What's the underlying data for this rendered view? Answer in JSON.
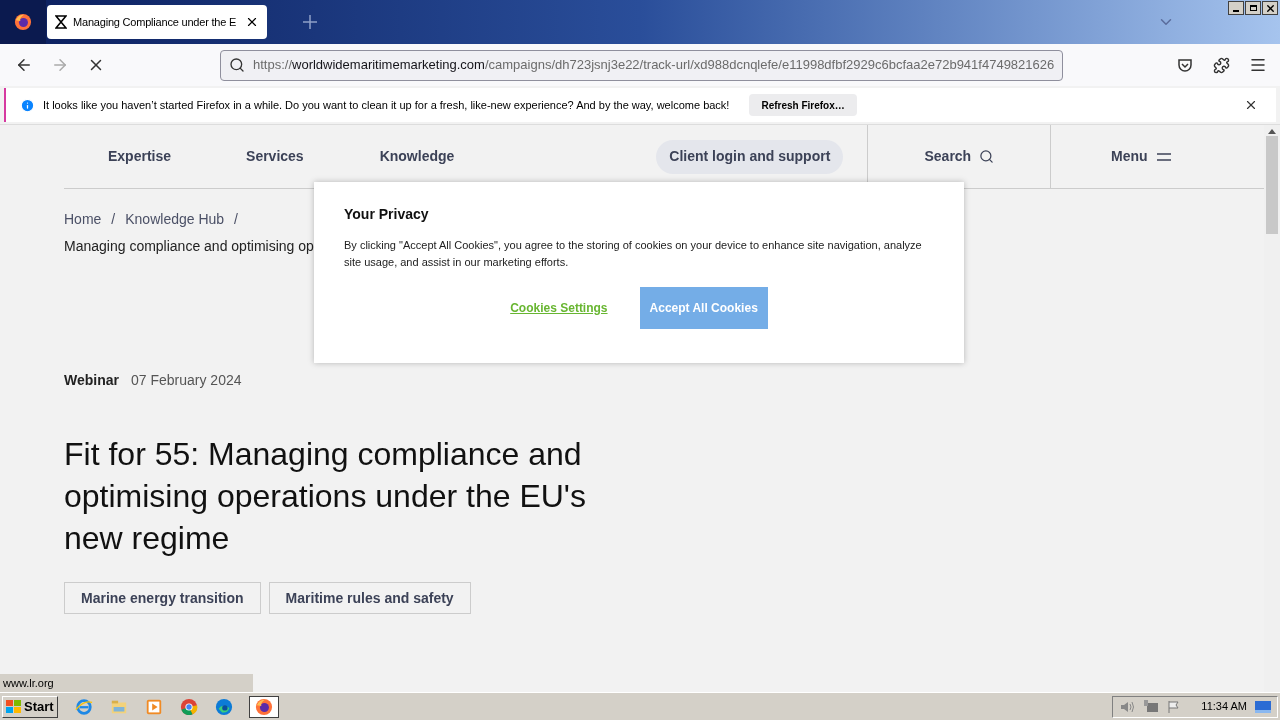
{
  "tabs": [
    {
      "title": "Managing Compliance under the E",
      "selected": true
    }
  ],
  "address_bar": {
    "url_prefix": "https://",
    "url_domain": "worldwidemaritimemarketing.com",
    "url_path": "/campaigns/dh723jsnj3e22/track-url/xd988dcnqlefe/e11998dfbf2929c6bcfaa2e72b941f4749821626"
  },
  "notification": {
    "message": "It looks like you haven’t started Firefox in a while. Do you want to clean it up for a fresh, like-new experience? And by the way, welcome back!",
    "button": "Refresh Firefox…"
  },
  "site_nav": {
    "items": [
      "Expertise",
      "Services",
      "Knowledge"
    ],
    "client_login": "Client login and support",
    "search": "Search",
    "menu": "Menu"
  },
  "breadcrumb": {
    "items": [
      "Home",
      "Knowledge Hub"
    ],
    "separator": "/",
    "current": "Managing compliance and optimising op"
  },
  "article": {
    "type": "Webinar",
    "date": "07 February 2024",
    "title": "Fit for 55: Managing compliance and optimising operations under the EU's new regime",
    "tags": [
      "Marine energy transition",
      "Maritime rules and safety"
    ]
  },
  "cookie_dialog": {
    "title": "Your Privacy",
    "text": "By clicking \"Accept All Cookies\", you agree to the storing of cookies on your device to enhance site navigation, analyze site usage, and assist in our marketing efforts.",
    "settings_link": "Cookies Settings",
    "accept_button": "Accept All Cookies"
  },
  "status_url": "www.lr.org",
  "taskbar": {
    "start": "Start",
    "apps": [
      {
        "kind": "ie",
        "selected": false
      },
      {
        "kind": "explorer",
        "selected": false
      },
      {
        "kind": "media",
        "selected": false
      },
      {
        "kind": "chrome",
        "selected": false
      },
      {
        "kind": "edge",
        "selected": false
      },
      {
        "kind": "firefox",
        "selected": true
      }
    ],
    "clock": "11:34 AM"
  }
}
